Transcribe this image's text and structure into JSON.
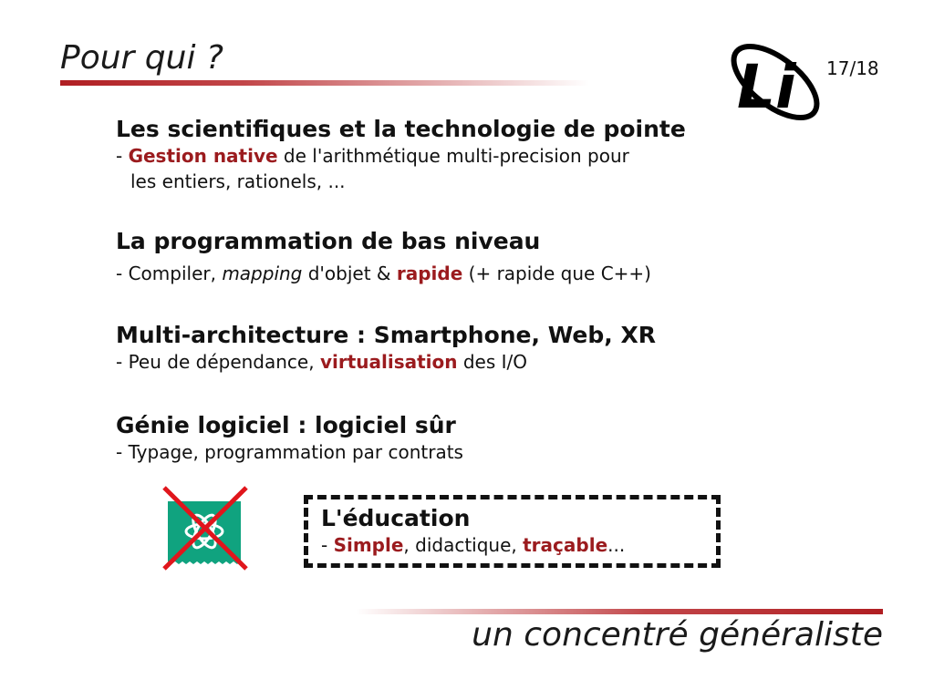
{
  "slide": {
    "title": "Pour qui ?",
    "page": "17/18",
    "logo_text": "Li",
    "footer": "un concentré généraliste"
  },
  "sections": [
    {
      "heading": "Les scientifiques et la technologie de pointe",
      "line1_prefix": "- ",
      "line1_highlight": "Gestion native",
      "line1_rest": " de l'arithmétique multi-precision pour",
      "line2": "les entiers, rationels, ..."
    },
    {
      "heading": "La programmation de bas niveau",
      "prefix": "- Compiler, ",
      "italic": "mapping",
      "middle": " d'objet & ",
      "highlight": "rapide",
      "rest": " (+ rapide que C++)"
    },
    {
      "heading": "Multi-architecture : Smartphone, Web, XR",
      "prefix": "- Peu de dépendance, ",
      "highlight": "virtualisation",
      "rest": " des I/O"
    },
    {
      "heading": "Génie logiciel : logiciel sûr",
      "line": "- Typage, programmation par contrats"
    }
  ],
  "education": {
    "heading": "L'éducation",
    "prefix": "- ",
    "highlight1": "Simple",
    "middle": ", didactique, ",
    "highlight2": "traçable",
    "rest": "..."
  },
  "colors": {
    "accent_red": "#9b1b1e",
    "rule_red": "#b01e22",
    "ai_icon_green": "#10a37f",
    "cross_red": "#e0161c"
  },
  "icons": {
    "logo": "li-logo",
    "crossed_out": "chatgpt-logo-icon"
  }
}
